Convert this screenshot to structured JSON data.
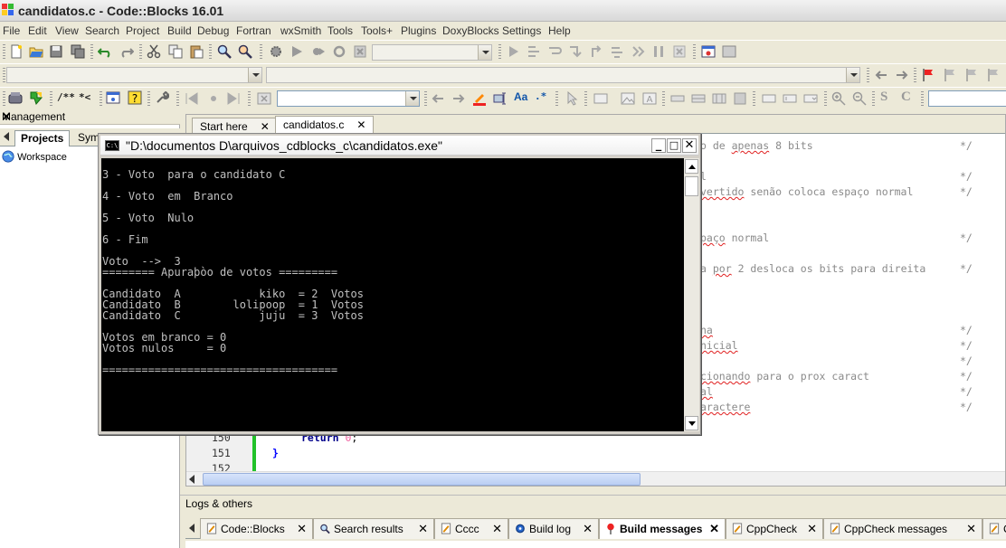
{
  "window": {
    "title": "candidatos.c - Code::Blocks 16.01"
  },
  "menu": [
    "File",
    "Edit",
    "View",
    "Search",
    "Project",
    "Build",
    "Debug",
    "Fortran",
    "wxSmith",
    "Tools",
    "Tools+",
    "Plugins",
    "DoxyBlocks",
    "Settings",
    "Help"
  ],
  "toolbar": {
    "doxy_comment": "/**",
    "doxy_line": "*<"
  },
  "management": {
    "title": "Management",
    "tabs": [
      "Projects",
      "Sym"
    ],
    "workspace": "Workspace"
  },
  "editor": {
    "tabs": [
      "Start here",
      "candidatos.c"
    ],
    "active_tab": "candidatos.c",
    "visible_lines": [
      {
        "num": "150",
        "code": "return 0;"
      },
      {
        "num": "151",
        "code": "}"
      },
      {
        "num": "152",
        "code": ""
      }
    ],
    "fragments": [
      {
        "pre": "o de ",
        "sp": "apenas",
        "post": " 8 bits"
      },
      {
        "pre": "",
        "sp": "",
        "post": "l"
      },
      {
        "pre": "",
        "sp": "vertido",
        "post": " senão coloca espaço normal"
      },
      {
        "pre": "",
        "sp": "paço",
        "post": " normal"
      },
      {
        "pre": "a ",
        "sp": "por",
        "post": " 2 desloca os bits para direita"
      },
      {
        "pre": "",
        "sp": "na",
        "post": ""
      },
      {
        "pre": "",
        "sp": "nicial",
        "post": ""
      },
      {
        "pre": "",
        "sp": "",
        "post": ""
      },
      {
        "pre": "",
        "sp": "cionando",
        "post": " para o prox caract"
      },
      {
        "pre": "",
        "sp": "al",
        "post": ""
      },
      {
        "pre": "",
        "sp": "aractere",
        "post": ""
      }
    ],
    "comment_end": "*/"
  },
  "console": {
    "title": "\"D:\\documentos D\\arquivos_cdblocks_c\\candidatos.exe\"",
    "lines": [
      "3 - Voto  para o candidato C",
      "",
      "4 - Voto  em  Branco",
      "",
      "5 - Voto  Nulo",
      "",
      "6 - Fim",
      "",
      "Voto  -->  3",
      "======== Apuraþòo de votos =========",
      "",
      "Candidato  A            kiko  = 2  Votos",
      "Candidato  B        lolipoop  = 1  Votos",
      "Candidato  C            juju  = 3  Votos",
      "",
      "Votos em branco = 0",
      "Votos nulos     = 0",
      "",
      "===================================="
    ]
  },
  "logs": {
    "title": "Logs & others",
    "tabs": [
      {
        "label": "Code::Blocks",
        "icon": "pencil-icon"
      },
      {
        "label": "Search results",
        "icon": "magnifier-icon"
      },
      {
        "label": "Cccc",
        "icon": "pencil-icon"
      },
      {
        "label": "Build log",
        "icon": "gear-icon"
      },
      {
        "label": "Build messages",
        "icon": "pin-icon"
      },
      {
        "label": "CppCheck",
        "icon": "pencil-icon"
      },
      {
        "label": "CppCheck messages",
        "icon": "pencil-icon"
      },
      {
        "label": "C",
        "icon": "pencil-icon"
      }
    ],
    "active_tab": "Build messages"
  },
  "colors": {
    "console_bg": "#000000",
    "console_text": "#c0c0c0",
    "gutter_changed": "#22c22a",
    "keyword": "#00008b"
  }
}
